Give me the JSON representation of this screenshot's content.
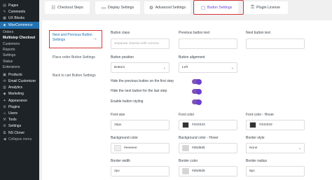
{
  "sidebar": {
    "items": [
      {
        "label": "Pages",
        "icon": "pages-icon",
        "glyph": "▤"
      },
      {
        "label": "Comments",
        "icon": "comments-icon",
        "glyph": "✎"
      },
      {
        "label": "UX Blocks",
        "icon": "blocks-icon",
        "glyph": "▦"
      },
      {
        "label": "WooCommerce",
        "icon": "woocommerce-icon",
        "glyph": "◈",
        "active": true
      },
      {
        "label": "Orders",
        "sub": true
      },
      {
        "label": "Multistep Checkout",
        "sub": true,
        "current": true
      },
      {
        "label": "Customers",
        "sub": true
      },
      {
        "label": "Reports",
        "sub": true
      },
      {
        "label": "Settings",
        "sub": true
      },
      {
        "label": "Status",
        "sub": true
      },
      {
        "label": "Extensions",
        "sub": true
      },
      {
        "label": "Products",
        "icon": "products-icon",
        "glyph": "▣"
      },
      {
        "label": "Email Customizer",
        "icon": "email-icon",
        "glyph": "✉"
      },
      {
        "label": "Analytics",
        "icon": "analytics-icon",
        "glyph": "▥"
      },
      {
        "label": "Marketing",
        "icon": "marketing-icon",
        "glyph": "◆"
      },
      {
        "label": "Appearance",
        "icon": "appearance-icon",
        "glyph": "✦"
      },
      {
        "label": "Plugins",
        "icon": "plugins-icon",
        "glyph": "⚙"
      },
      {
        "label": "Users",
        "icon": "users-icon",
        "glyph": "☺"
      },
      {
        "label": "Tools",
        "icon": "tools-icon",
        "glyph": "⚒"
      },
      {
        "label": "Settings",
        "icon": "settings-icon",
        "glyph": "⚙"
      },
      {
        "label": "NS Cloner",
        "icon": "cloner-icon",
        "glyph": "⧉"
      },
      {
        "label": "Collapse menu",
        "icon": "collapse-icon",
        "glyph": "◀",
        "collapse": true
      }
    ]
  },
  "tabs": [
    {
      "label": "Checkout Steps",
      "icon": "checkout-steps-icon",
      "glyph": "☷"
    },
    {
      "label": "Display Settings",
      "icon": "display-settings-icon",
      "glyph": "▭"
    },
    {
      "label": "Advanced Settings",
      "icon": "advanced-settings-icon",
      "glyph": "⚙"
    },
    {
      "label": "Button Settings",
      "icon": "button-settings-icon",
      "glyph": "▢",
      "active": true
    },
    {
      "label": "Plugin License",
      "icon": "plugin-license-icon",
      "glyph": "⚿"
    }
  ],
  "settings_nav": [
    {
      "label": "Next and Previous Button Settings",
      "active": true
    },
    {
      "label": "Place order Button Settings"
    },
    {
      "label": "Back to cart Button Settings"
    }
  ],
  "form": {
    "button_class": {
      "label": "Button class",
      "placeholder": "Separate classes with comma"
    },
    "previous_text": {
      "label": "Previous button text"
    },
    "next_text": {
      "label": "Next button text"
    },
    "button_position": {
      "label": "Button position",
      "value": "Bottom"
    },
    "button_alignment": {
      "label": "Button alignment",
      "value": "Left"
    },
    "toggle_prev": {
      "label": "Hide the previous button on the first step",
      "on": true
    },
    "toggle_next": {
      "label": "Hide the next button for the last step",
      "on": true
    },
    "toggle_style": {
      "label": "Enable button styling",
      "on": true
    },
    "font_size": {
      "label": "Font size",
      "value": "16px"
    },
    "font_color": {
      "label": "Font color",
      "value": "#333333",
      "color": "#333333"
    },
    "font_color_hover": {
      "label": "Font color - Hover",
      "value": "#333333",
      "color": "#333333"
    },
    "bg_color": {
      "label": "Background color",
      "value": "#eeeeee",
      "color": "#eeeeee"
    },
    "bg_color_hover": {
      "label": "Background color - Hover",
      "value": "#d5d5d5",
      "color": "#d5d5d5"
    },
    "border_style": {
      "label": "Border style",
      "value": "None"
    },
    "border_width": {
      "label": "Border width",
      "value": "2px"
    },
    "border_color": {
      "label": "Border color",
      "value": "#d5d5d5",
      "color": "#d5d5d5"
    },
    "border_radius": {
      "label": "Border radius",
      "value": "5px"
    }
  },
  "colors": {
    "accent": "#6b3fd1",
    "highlight": "#d63638",
    "wp_blue": "#2271b1",
    "sidebar_bg": "#1d2327"
  }
}
